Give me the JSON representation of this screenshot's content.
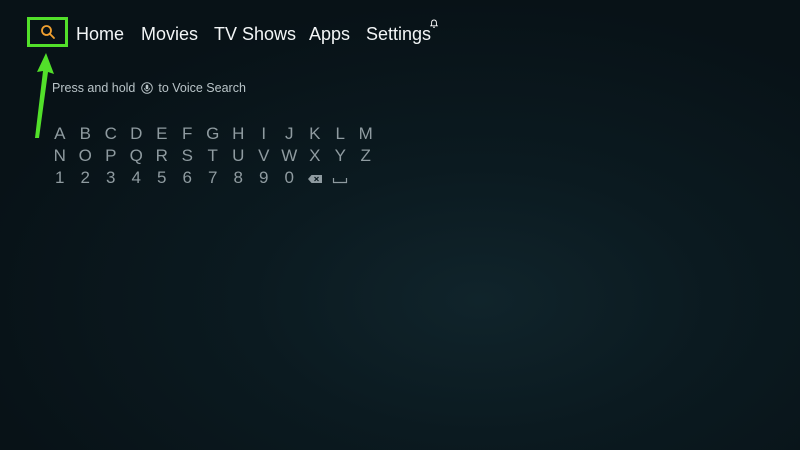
{
  "nav": {
    "items": [
      {
        "label": "Home"
      },
      {
        "label": "Movies"
      },
      {
        "label": "TV Shows"
      },
      {
        "label": "Apps"
      },
      {
        "label": "Settings"
      }
    ]
  },
  "search": {
    "hint_before": "Press and hold",
    "hint_after": "to Voice Search"
  },
  "keyboard": {
    "row1": [
      "A",
      "B",
      "C",
      "D",
      "E",
      "F",
      "G",
      "H",
      "I",
      "J",
      "K",
      "L",
      "M"
    ],
    "row2": [
      "N",
      "O",
      "P",
      "Q",
      "R",
      "S",
      "T",
      "U",
      "V",
      "W",
      "X",
      "Y",
      "Z"
    ],
    "row3": [
      "1",
      "2",
      "3",
      "4",
      "5",
      "6",
      "7",
      "8",
      "9",
      "0"
    ]
  },
  "colors": {
    "highlight": "#52e02a",
    "search_icon": "#f0a030",
    "background": "#0b1a20"
  }
}
